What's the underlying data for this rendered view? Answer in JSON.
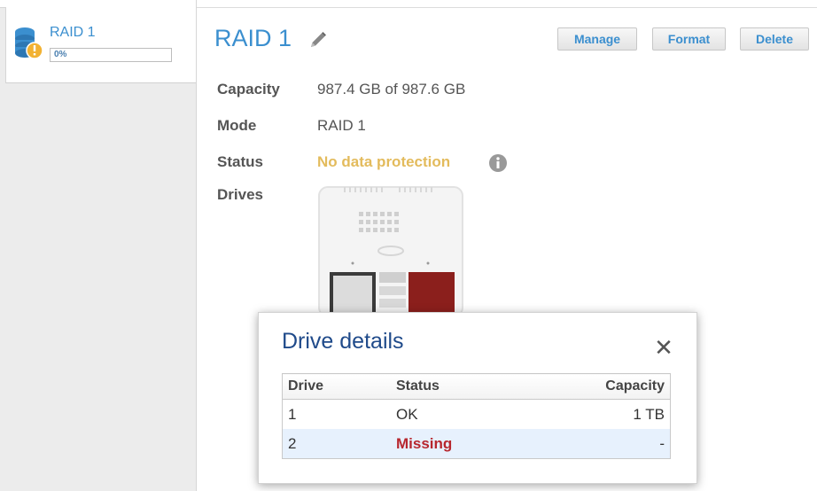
{
  "sidebar": {
    "volume": {
      "name": "RAID 1",
      "progress_text": "0%",
      "progress_value": 0
    }
  },
  "volume": {
    "title": "RAID 1",
    "buttons": {
      "manage": "Manage",
      "format": "Format",
      "delete": "Delete"
    },
    "fields": {
      "capacity_label": "Capacity",
      "capacity_value": "987.4 GB of 987.6 GB",
      "mode_label": "Mode",
      "mode_value": "RAID 1",
      "status_label": "Status",
      "status_value": "No data protection",
      "drives_label": "Drives"
    }
  },
  "colors": {
    "accent": "#3b8fcf",
    "warning": "#e3bb5c",
    "missing": "#b7272e",
    "drive_missing_slot": "#8b1f1c"
  },
  "drive_details": {
    "title": "Drive details",
    "close_icon": "close-icon",
    "columns": [
      "Drive",
      "Status",
      "Capacity"
    ],
    "rows": [
      {
        "drive": "1",
        "status": "OK",
        "capacity": "1 TB"
      },
      {
        "drive": "2",
        "status": "Missing",
        "capacity": "-"
      }
    ]
  }
}
